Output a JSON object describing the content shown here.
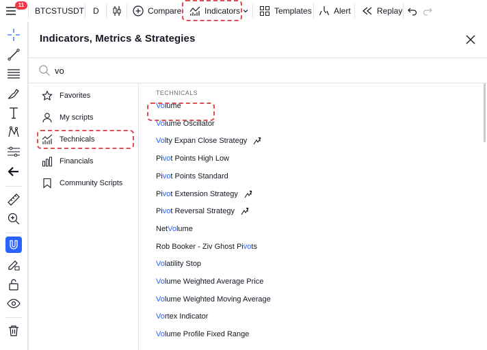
{
  "topbar": {
    "notification_count": "11",
    "symbol": "BTCSTUSDT",
    "interval": "D",
    "compare_label": "Compare",
    "indicators_label": "Indicators",
    "templates_label": "Templates",
    "alert_label": "Alert",
    "replay_label": "Replay"
  },
  "dialog": {
    "title": "Indicators, Metrics & Strategies",
    "search": {
      "value": "vo",
      "placeholder": ""
    },
    "categories": [
      {
        "label": "Favorites",
        "icon": "star-icon"
      },
      {
        "label": "My scripts",
        "icon": "user-icon"
      },
      {
        "label": "Technicals",
        "icon": "chart-icon"
      },
      {
        "label": "Financials",
        "icon": "bars-icon"
      },
      {
        "label": "Community Scripts",
        "icon": "bookmark-icon"
      }
    ],
    "results_heading": "TECHNICALS",
    "results": [
      {
        "pre": "",
        "match": "Vo",
        "post": "lume",
        "strategy": false
      },
      {
        "pre": "",
        "match": "Vo",
        "post": "lume Oscillator",
        "strategy": false
      },
      {
        "pre": "",
        "match": "Vo",
        "post": "lty Expan Close Strategy",
        "strategy": true
      },
      {
        "pre": "Pi",
        "match": "vo",
        "post": "t Points High Low",
        "strategy": false
      },
      {
        "pre": "Pi",
        "match": "vo",
        "post": "t Points Standard",
        "strategy": false
      },
      {
        "pre": "Pi",
        "match": "vo",
        "post": "t Extension Strategy",
        "strategy": true
      },
      {
        "pre": "Pi",
        "match": "vo",
        "post": "t Reversal Strategy",
        "strategy": true
      },
      {
        "pre": "Net ",
        "match": "Vo",
        "post": "lume",
        "strategy": false
      },
      {
        "pre": "Rob Booker - Ziv Ghost Pi",
        "match": "vo",
        "post": "ts",
        "strategy": false
      },
      {
        "pre": "",
        "match": "Vo",
        "post": "latility Stop",
        "strategy": false
      },
      {
        "pre": "",
        "match": "Vo",
        "post": "lume Weighted Average Price",
        "strategy": false
      },
      {
        "pre": "",
        "match": "Vo",
        "post": "lume Weighted Moving Average",
        "strategy": false
      },
      {
        "pre": "",
        "match": "Vo",
        "post": "rtex Indicator",
        "strategy": false
      },
      {
        "pre": "",
        "match": "Vo",
        "post": "lume Profile Fixed Range",
        "strategy": false
      }
    ]
  },
  "colors": {
    "accent": "#2962ff",
    "badge": "#f23645",
    "highlight_box": "#e04a52"
  }
}
